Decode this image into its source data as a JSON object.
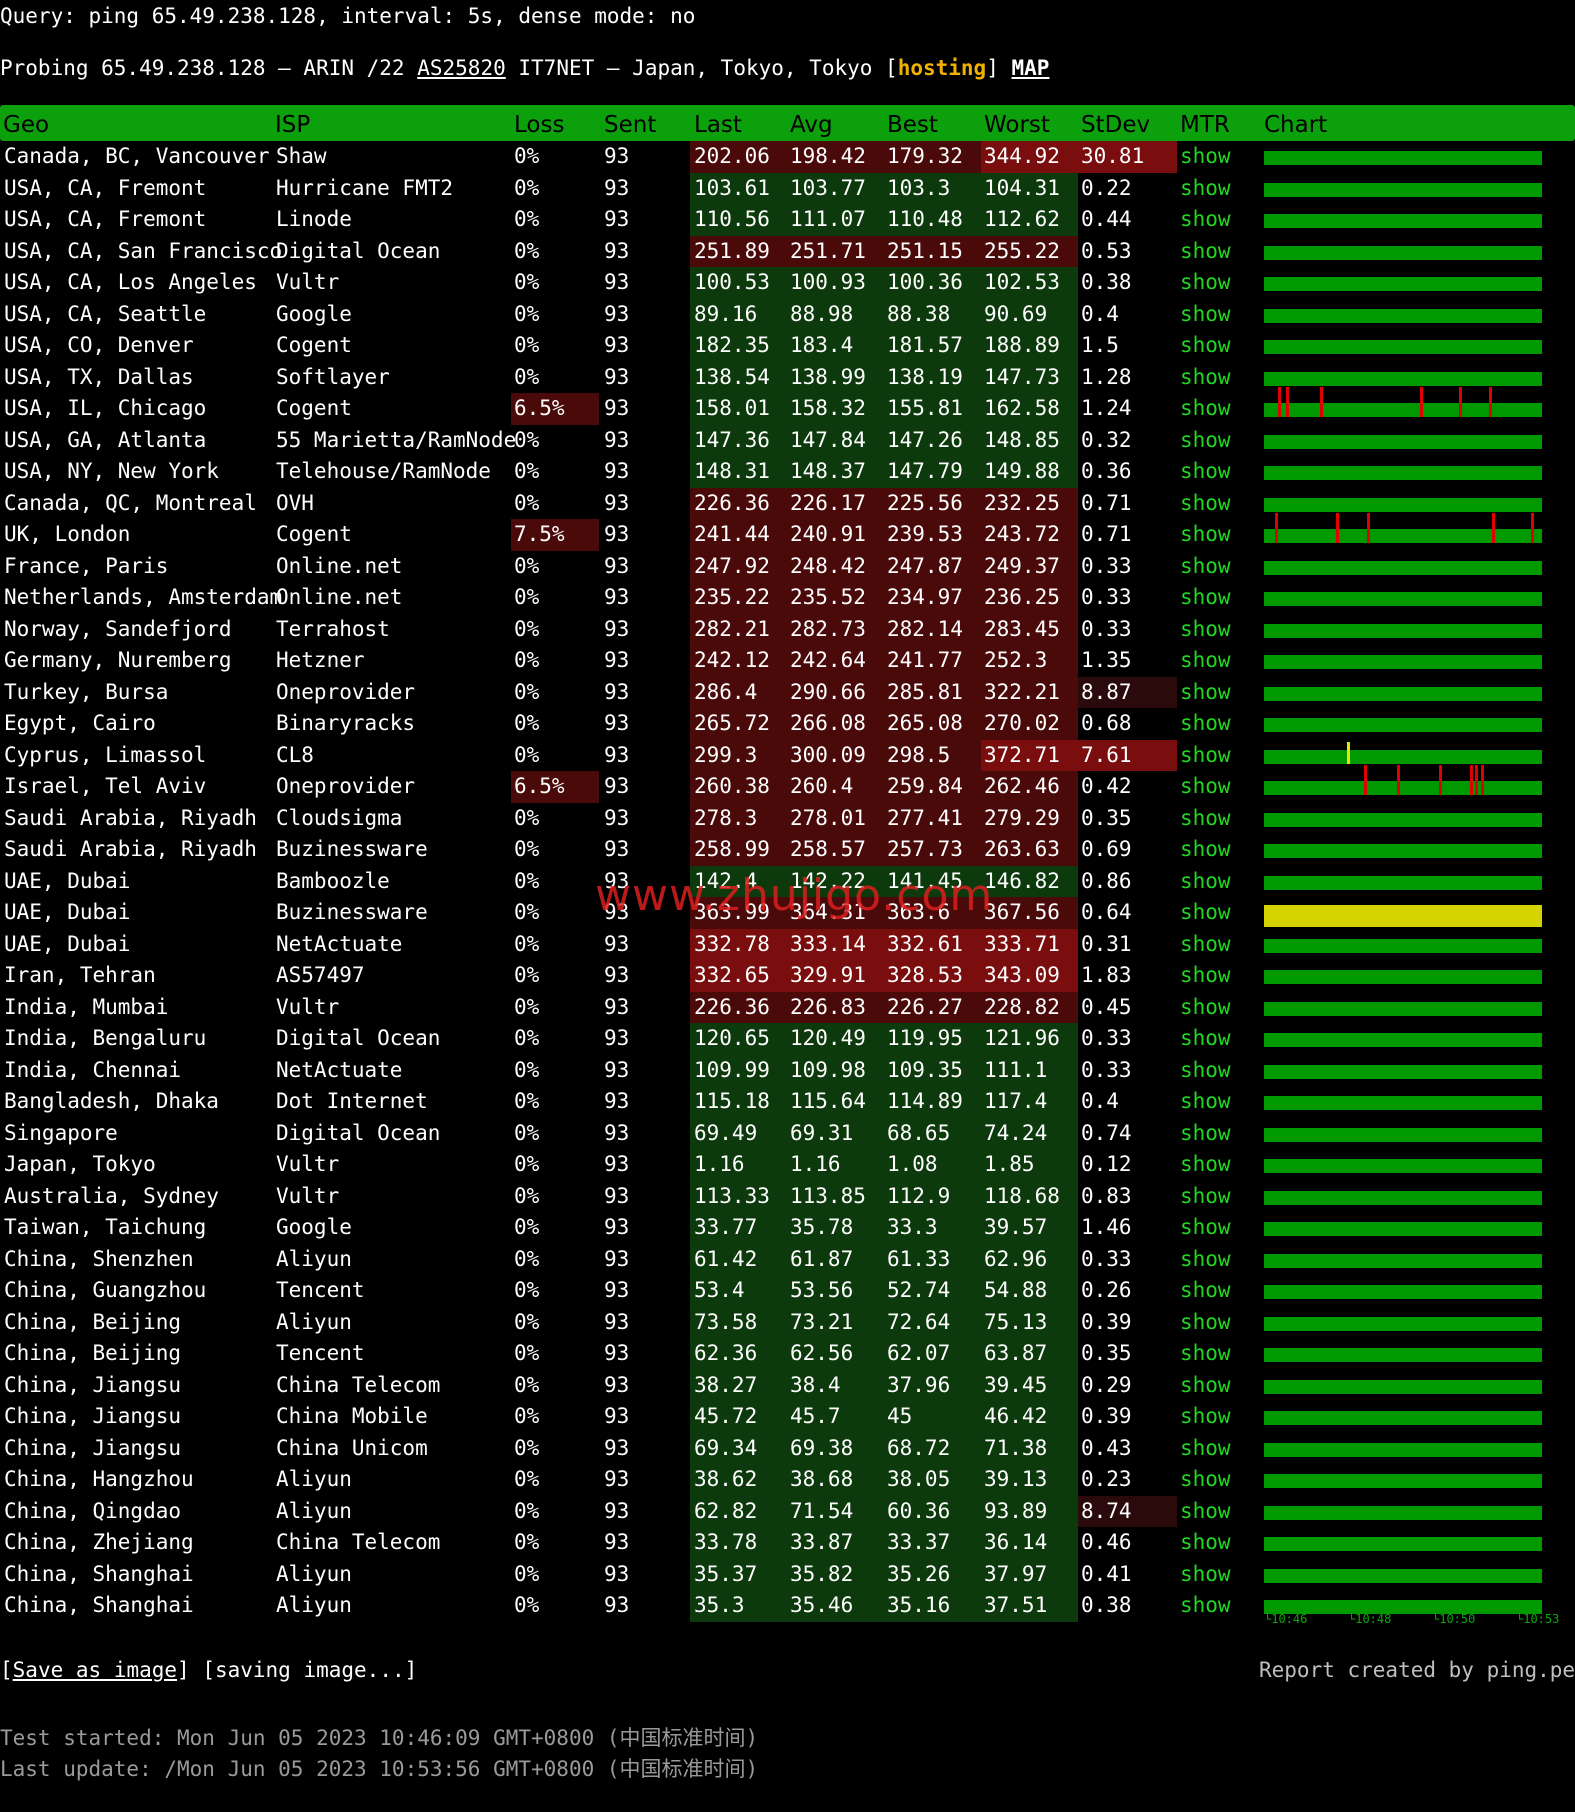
{
  "query_line": "Query: ping 65.49.238.128, interval: 5s, dense mode: no",
  "probe": {
    "prefix": "Probing 65.49.238.128 – ARIN /22 ",
    "asn": "AS25820",
    "middle": " IT7NET – Japan, Tokyo, Tokyo [",
    "tag": "hosting",
    "suffix": "] ",
    "map": "MAP"
  },
  "columns": [
    "Geo",
    "ISP",
    "Loss",
    "Sent",
    "Last",
    "Avg",
    "Best",
    "Worst",
    "StDev",
    "MTR",
    "Chart"
  ],
  "mtr_label": "show",
  "colors": {
    "header_bg": "#0ca00c",
    "good_bg": "#0c3a0c",
    "bad_bg": "#4a0a0a",
    "worse_bg": "#7a0e0e",
    "mild_bg": "#2a0a0a",
    "show_link": "#1fd81f",
    "chart_ok": "#009a00",
    "chart_loss": "#e00000",
    "chart_spike": "#e6e600"
  },
  "rows": [
    {
      "geo": "Canada, BC, Vancouver",
      "isp": "Shaw",
      "loss": "0%",
      "sent": "93",
      "last": "202.06",
      "avg": "198.42",
      "best": "179.32",
      "worst": "344.92",
      "stdev": "30.81",
      "lat": "bad",
      "worst_hi": true,
      "stdev_hi": true,
      "loss_hi": false,
      "chart": "ok"
    },
    {
      "geo": "USA, CA, Fremont",
      "isp": "Hurricane FMT2",
      "loss": "0%",
      "sent": "93",
      "last": "103.61",
      "avg": "103.77",
      "best": "103.3",
      "worst": "104.31",
      "stdev": "0.22",
      "lat": "good",
      "chart": "ok"
    },
    {
      "geo": "USA, CA, Fremont",
      "isp": "Linode",
      "loss": "0%",
      "sent": "93",
      "last": "110.56",
      "avg": "111.07",
      "best": "110.48",
      "worst": "112.62",
      "stdev": "0.44",
      "lat": "good",
      "chart": "ok"
    },
    {
      "geo": "USA, CA, San Francisco",
      "isp": "Digital Ocean",
      "loss": "0%",
      "sent": "93",
      "last": "251.89",
      "avg": "251.71",
      "best": "251.15",
      "worst": "255.22",
      "stdev": "0.53",
      "lat": "bad",
      "chart": "ok"
    },
    {
      "geo": "USA, CA, Los Angeles",
      "isp": "Vultr",
      "loss": "0%",
      "sent": "93",
      "last": "100.53",
      "avg": "100.93",
      "best": "100.36",
      "worst": "102.53",
      "stdev": "0.38",
      "lat": "good",
      "chart": "ok"
    },
    {
      "geo": "USA, CA, Seattle",
      "isp": "Google",
      "loss": "0%",
      "sent": "93",
      "last": "89.16",
      "avg": "88.98",
      "best": "88.38",
      "worst": "90.69",
      "stdev": "0.4",
      "lat": "good",
      "chart": "ok"
    },
    {
      "geo": "USA, CO, Denver",
      "isp": "Cogent",
      "loss": "0%",
      "sent": "93",
      "last": "182.35",
      "avg": "183.4",
      "best": "181.57",
      "worst": "188.89",
      "stdev": "1.5",
      "lat": "good",
      "chart": "ok"
    },
    {
      "geo": "USA, TX, Dallas",
      "isp": "Softlayer",
      "loss": "0%",
      "sent": "93",
      "last": "138.54",
      "avg": "138.99",
      "best": "138.19",
      "worst": "147.73",
      "stdev": "1.28",
      "lat": "good",
      "chart": "ok"
    },
    {
      "geo": "USA, IL, Chicago",
      "isp": "Cogent",
      "loss": "6.5%",
      "sent": "93",
      "last": "158.01",
      "avg": "158.32",
      "best": "155.81",
      "worst": "162.58",
      "stdev": "1.24",
      "lat": "good",
      "loss_hi": true,
      "chart": "loss",
      "ticks": [
        0.05,
        0.08,
        0.2,
        0.56,
        0.7,
        0.81
      ]
    },
    {
      "geo": "USA, GA, Atlanta",
      "isp": "55 Marietta/RamNode",
      "loss": "0%",
      "sent": "93",
      "last": "147.36",
      "avg": "147.84",
      "best": "147.26",
      "worst": "148.85",
      "stdev": "0.32",
      "lat": "good",
      "chart": "ok"
    },
    {
      "geo": "USA, NY, New York",
      "isp": "Telehouse/RamNode",
      "loss": "0%",
      "sent": "93",
      "last": "148.31",
      "avg": "148.37",
      "best": "147.79",
      "worst": "149.88",
      "stdev": "0.36",
      "lat": "good",
      "chart": "ok"
    },
    {
      "geo": "Canada, QC, Montreal",
      "isp": "OVH",
      "loss": "0%",
      "sent": "93",
      "last": "226.36",
      "avg": "226.17",
      "best": "225.56",
      "worst": "232.25",
      "stdev": "0.71",
      "lat": "bad",
      "chart": "ok"
    },
    {
      "geo": "UK, London",
      "isp": "Cogent",
      "loss": "7.5%",
      "sent": "93",
      "last": "241.44",
      "avg": "240.91",
      "best": "239.53",
      "worst": "243.72",
      "stdev": "0.71",
      "lat": "bad",
      "loss_hi": true,
      "chart": "loss",
      "ticks": [
        0.04,
        0.26,
        0.37,
        0.82,
        0.96
      ]
    },
    {
      "geo": "France, Paris",
      "isp": "Online.net",
      "loss": "0%",
      "sent": "93",
      "last": "247.92",
      "avg": "248.42",
      "best": "247.87",
      "worst": "249.37",
      "stdev": "0.33",
      "lat": "bad",
      "chart": "ok"
    },
    {
      "geo": "Netherlands, Amsterdam",
      "isp": "Online.net",
      "loss": "0%",
      "sent": "93",
      "last": "235.22",
      "avg": "235.52",
      "best": "234.97",
      "worst": "236.25",
      "stdev": "0.33",
      "lat": "bad",
      "chart": "ok"
    },
    {
      "geo": "Norway, Sandefjord",
      "isp": "Terrahost",
      "loss": "0%",
      "sent": "93",
      "last": "282.21",
      "avg": "282.73",
      "best": "282.14",
      "worst": "283.45",
      "stdev": "0.33",
      "lat": "bad",
      "chart": "ok"
    },
    {
      "geo": "Germany, Nuremberg",
      "isp": "Hetzner",
      "loss": "0%",
      "sent": "93",
      "last": "242.12",
      "avg": "242.64",
      "best": "241.77",
      "worst": "252.3",
      "stdev": "1.35",
      "lat": "bad",
      "chart": "ok"
    },
    {
      "geo": "Turkey, Bursa",
      "isp": "Oneprovider",
      "loss": "0%",
      "sent": "93",
      "last": "286.4",
      "avg": "290.66",
      "best": "285.81",
      "worst": "322.21",
      "stdev": "8.87",
      "lat": "bad",
      "stdev_hi": true,
      "chart": "ok"
    },
    {
      "geo": "Egypt, Cairo",
      "isp": "Binaryracks",
      "loss": "0%",
      "sent": "93",
      "last": "265.72",
      "avg": "266.08",
      "best": "265.08",
      "worst": "270.02",
      "stdev": "0.68",
      "lat": "bad",
      "chart": "ok"
    },
    {
      "geo": "Cyprus, Limassol",
      "isp": "CL8",
      "loss": "0%",
      "sent": "93",
      "last": "299.3",
      "avg": "300.09",
      "best": "298.5",
      "worst": "372.71",
      "stdev": "7.61",
      "lat": "bad",
      "worst_hi": true,
      "stdev_hi": true,
      "chart": "spike",
      "ticks": [
        0.3
      ]
    },
    {
      "geo": "Israel, Tel Aviv",
      "isp": "Oneprovider",
      "loss": "6.5%",
      "sent": "93",
      "last": "260.38",
      "avg": "260.4",
      "best": "259.84",
      "worst": "262.46",
      "stdev": "0.42",
      "lat": "bad",
      "loss_hi": true,
      "chart": "loss",
      "ticks": [
        0.36,
        0.48,
        0.63,
        0.74,
        0.76,
        0.78
      ]
    },
    {
      "geo": "Saudi Arabia, Riyadh",
      "isp": "Cloudsigma",
      "loss": "0%",
      "sent": "93",
      "last": "278.3",
      "avg": "278.01",
      "best": "277.41",
      "worst": "279.29",
      "stdev": "0.35",
      "lat": "bad",
      "chart": "ok"
    },
    {
      "geo": "Saudi Arabia, Riyadh",
      "isp": "Buzinessware",
      "loss": "0%",
      "sent": "93",
      "last": "258.99",
      "avg": "258.57",
      "best": "257.73",
      "worst": "263.63",
      "stdev": "0.69",
      "lat": "bad",
      "chart": "ok"
    },
    {
      "geo": "UAE, Dubai",
      "isp": "Bamboozle",
      "loss": "0%",
      "sent": "93",
      "last": "142.4",
      "avg": "142.22",
      "best": "141.45",
      "worst": "146.82",
      "stdev": "0.86",
      "lat": "good",
      "chart": "ok"
    },
    {
      "geo": "UAE, Dubai",
      "isp": "Buzinessware",
      "loss": "0%",
      "sent": "93",
      "last": "363.99",
      "avg": "364.31",
      "best": "363.6",
      "worst": "367.56",
      "stdev": "0.64",
      "lat": "bad",
      "chart": "yellow"
    },
    {
      "geo": "UAE, Dubai",
      "isp": "NetActuate",
      "loss": "0%",
      "sent": "93",
      "last": "332.78",
      "avg": "333.14",
      "best": "332.61",
      "worst": "333.71",
      "stdev": "0.31",
      "lat": "worse",
      "chart": "ok"
    },
    {
      "geo": "Iran, Tehran",
      "isp": "AS57497",
      "loss": "0%",
      "sent": "93",
      "last": "332.65",
      "avg": "329.91",
      "best": "328.53",
      "worst": "343.09",
      "stdev": "1.83",
      "lat": "worse",
      "chart": "ok"
    },
    {
      "geo": "India, Mumbai",
      "isp": "Vultr",
      "loss": "0%",
      "sent": "93",
      "last": "226.36",
      "avg": "226.83",
      "best": "226.27",
      "worst": "228.82",
      "stdev": "0.45",
      "lat": "bad",
      "chart": "ok"
    },
    {
      "geo": "India, Bengaluru",
      "isp": "Digital Ocean",
      "loss": "0%",
      "sent": "93",
      "last": "120.65",
      "avg": "120.49",
      "best": "119.95",
      "worst": "121.96",
      "stdev": "0.33",
      "lat": "good",
      "chart": "ok"
    },
    {
      "geo": "India, Chennai",
      "isp": "NetActuate",
      "loss": "0%",
      "sent": "93",
      "last": "109.99",
      "avg": "109.98",
      "best": "109.35",
      "worst": "111.1",
      "stdev": "0.33",
      "lat": "good",
      "chart": "ok"
    },
    {
      "geo": "Bangladesh, Dhaka",
      "isp": "Dot Internet",
      "loss": "0%",
      "sent": "93",
      "last": "115.18",
      "avg": "115.64",
      "best": "114.89",
      "worst": "117.4",
      "stdev": "0.4",
      "lat": "good",
      "chart": "ok"
    },
    {
      "geo": "Singapore",
      "isp": "Digital Ocean",
      "loss": "0%",
      "sent": "93",
      "last": "69.49",
      "avg": "69.31",
      "best": "68.65",
      "worst": "74.24",
      "stdev": "0.74",
      "lat": "good",
      "chart": "ok"
    },
    {
      "geo": "Japan, Tokyo",
      "isp": "Vultr",
      "loss": "0%",
      "sent": "93",
      "last": "1.16",
      "avg": "1.16",
      "best": "1.08",
      "worst": "1.85",
      "stdev": "0.12",
      "lat": "good",
      "chart": "ok"
    },
    {
      "geo": "Australia, Sydney",
      "isp": "Vultr",
      "loss": "0%",
      "sent": "93",
      "last": "113.33",
      "avg": "113.85",
      "best": "112.9",
      "worst": "118.68",
      "stdev": "0.83",
      "lat": "good",
      "chart": "ok"
    },
    {
      "geo": "Taiwan, Taichung",
      "isp": "Google",
      "loss": "0%",
      "sent": "93",
      "last": "33.77",
      "avg": "35.78",
      "best": "33.3",
      "worst": "39.57",
      "stdev": "1.46",
      "lat": "good",
      "chart": "ok"
    },
    {
      "geo": "China, Shenzhen",
      "isp": "Aliyun",
      "loss": "0%",
      "sent": "93",
      "last": "61.42",
      "avg": "61.87",
      "best": "61.33",
      "worst": "62.96",
      "stdev": "0.33",
      "lat": "good",
      "chart": "ok"
    },
    {
      "geo": "China, Guangzhou",
      "isp": "Tencent",
      "loss": "0%",
      "sent": "93",
      "last": "53.4",
      "avg": "53.56",
      "best": "52.74",
      "worst": "54.88",
      "stdev": "0.26",
      "lat": "good",
      "chart": "ok"
    },
    {
      "geo": "China, Beijing",
      "isp": "Aliyun",
      "loss": "0%",
      "sent": "93",
      "last": "73.58",
      "avg": "73.21",
      "best": "72.64",
      "worst": "75.13",
      "stdev": "0.39",
      "lat": "good",
      "chart": "ok"
    },
    {
      "geo": "China, Beijing",
      "isp": "Tencent",
      "loss": "0%",
      "sent": "93",
      "last": "62.36",
      "avg": "62.56",
      "best": "62.07",
      "worst": "63.87",
      "stdev": "0.35",
      "lat": "good",
      "chart": "ok"
    },
    {
      "geo": "China, Jiangsu",
      "isp": "China Telecom",
      "loss": "0%",
      "sent": "93",
      "last": "38.27",
      "avg": "38.4",
      "best": "37.96",
      "worst": "39.45",
      "stdev": "0.29",
      "lat": "good",
      "chart": "ok"
    },
    {
      "geo": "China, Jiangsu",
      "isp": "China Mobile",
      "loss": "0%",
      "sent": "93",
      "last": "45.72",
      "avg": "45.7",
      "best": "45",
      "worst": "46.42",
      "stdev": "0.39",
      "lat": "good",
      "chart": "ok"
    },
    {
      "geo": "China, Jiangsu",
      "isp": "China Unicom",
      "loss": "0%",
      "sent": "93",
      "last": "69.34",
      "avg": "69.38",
      "best": "68.72",
      "worst": "71.38",
      "stdev": "0.43",
      "lat": "good",
      "chart": "ok"
    },
    {
      "geo": "China, Hangzhou",
      "isp": "Aliyun",
      "loss": "0%",
      "sent": "93",
      "last": "38.62",
      "avg": "38.68",
      "best": "38.05",
      "worst": "39.13",
      "stdev": "0.23",
      "lat": "good",
      "chart": "ok"
    },
    {
      "geo": "China, Qingdao",
      "isp": "Aliyun",
      "loss": "0%",
      "sent": "93",
      "last": "62.82",
      "avg": "71.54",
      "best": "60.36",
      "worst": "93.89",
      "stdev": "8.74",
      "lat": "good",
      "stdev_hi": true,
      "chart": "ok"
    },
    {
      "geo": "China, Zhejiang",
      "isp": "China Telecom",
      "loss": "0%",
      "sent": "93",
      "last": "33.78",
      "avg": "33.87",
      "best": "33.37",
      "worst": "36.14",
      "stdev": "0.46",
      "lat": "good",
      "chart": "ok"
    },
    {
      "geo": "China, Shanghai",
      "isp": "Aliyun",
      "loss": "0%",
      "sent": "93",
      "last": "35.37",
      "avg": "35.82",
      "best": "35.26",
      "worst": "37.97",
      "stdev": "0.41",
      "lat": "good",
      "chart": "ok"
    },
    {
      "geo": "China, Shanghai",
      "isp": "Aliyun",
      "loss": "0%",
      "sent": "93",
      "last": "35.3",
      "avg": "35.46",
      "best": "35.16",
      "worst": "37.51",
      "stdev": "0.38",
      "lat": "good",
      "chart": "ok"
    }
  ],
  "chart_axis_labels": [
    "└10:46",
    "└10:48",
    "└10:50",
    "└10:53"
  ],
  "watermark": "www.zhujigo.com",
  "footer": {
    "save_open": "[",
    "save_link": "Save as image",
    "save_close": "] [saving image...]",
    "credit": "Report created by ping.pe",
    "started": "Test started: Mon Jun 05 2023 10:46:09 GMT+0800 (中国标准时间)",
    "updated": "Last update: /Mon Jun 05 2023 10:53:56 GMT+0800 (中国标准时间)"
  }
}
